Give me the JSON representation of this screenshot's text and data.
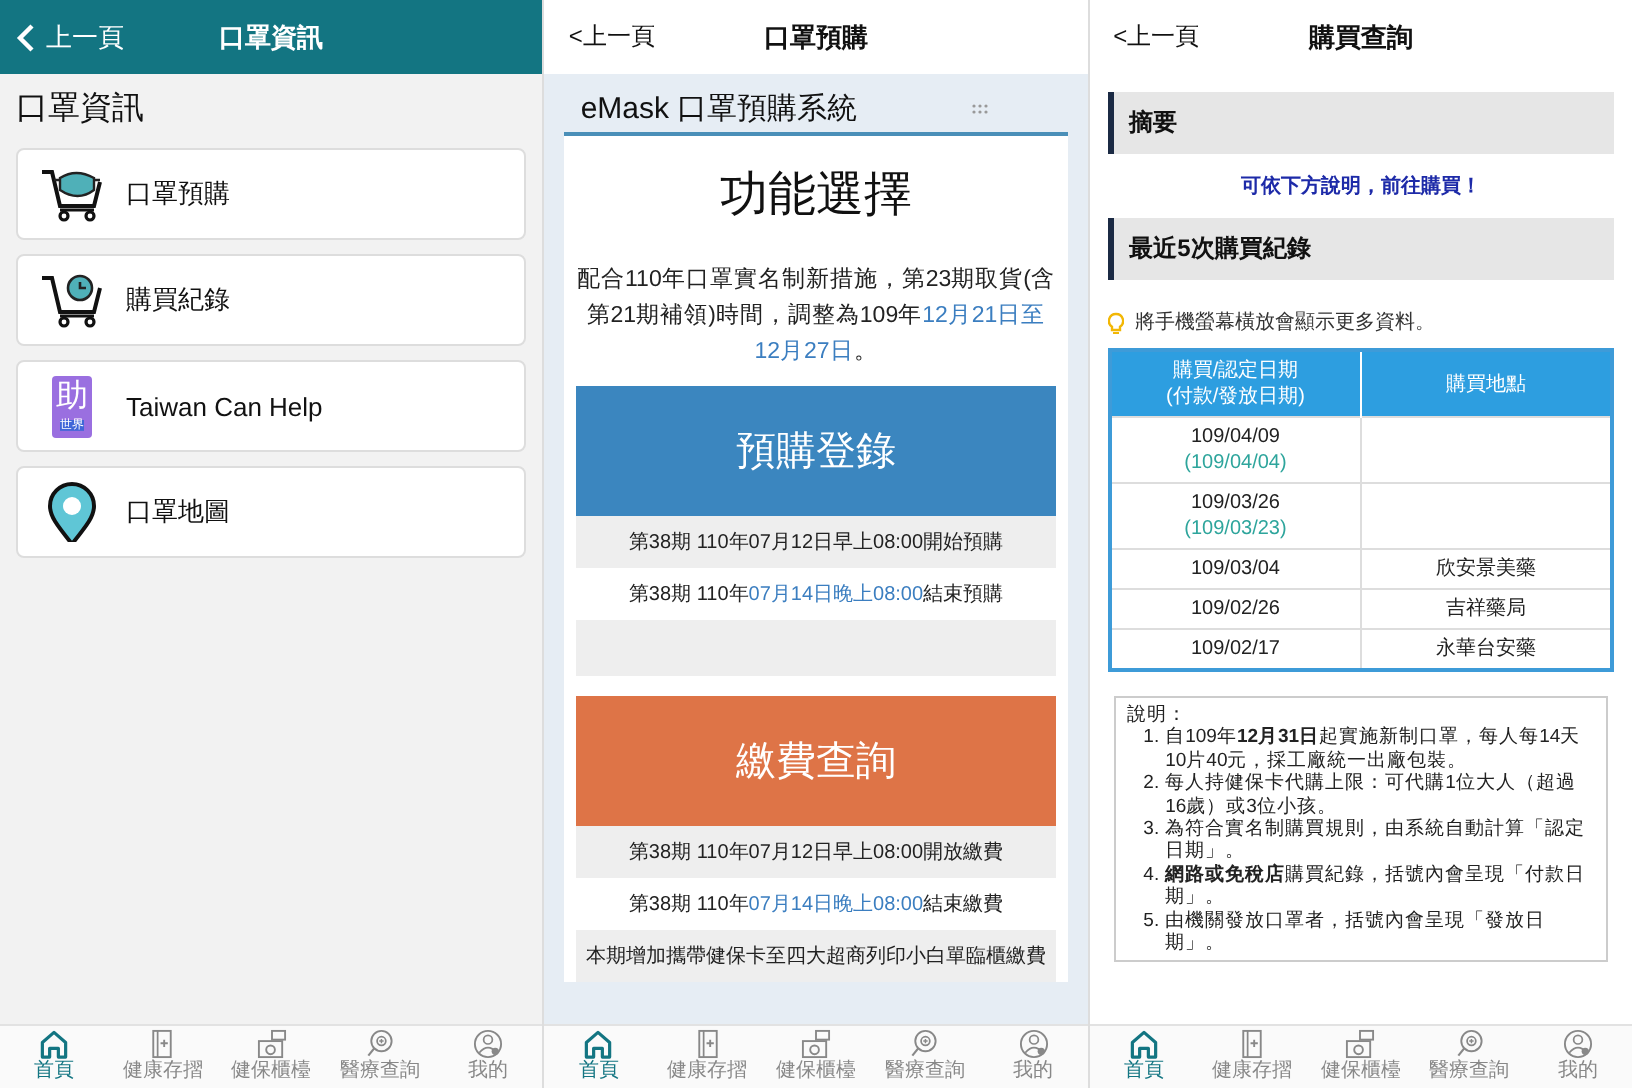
{
  "screens": [
    {
      "kind": "menu",
      "header": {
        "back": "上一頁",
        "title": "口罩資訊"
      },
      "heading": "口罩資訊",
      "items": [
        {
          "kind": "cart-mask",
          "label": "口罩預購"
        },
        {
          "kind": "cart-clock",
          "label": "購買紀錄"
        },
        {
          "kind": "badge",
          "badge_text": "助",
          "badge_caption": "世界",
          "label": "Taiwan Can Help"
        },
        {
          "kind": "pin",
          "label": "口罩地圖"
        }
      ],
      "nav": [
        {
          "kind": "home",
          "label": "首頁",
          "selected": true
        },
        {
          "kind": "passbook",
          "label": "健康存摺",
          "selected": false
        },
        {
          "kind": "counter",
          "label": "健保櫃檯",
          "selected": false
        },
        {
          "kind": "search",
          "label": "醫療查詢",
          "selected": false
        },
        {
          "kind": "profile",
          "label": "我的",
          "selected": false
        }
      ]
    },
    {
      "kind": "booking",
      "header": {
        "back": "<上一頁",
        "title": "口罩預購"
      },
      "system_title": "eMask 口罩預購系統",
      "heading": "功能選擇",
      "notice": [
        {
          "text": "配合110年口罩實名制新措施，第23期取貨(含第21期補領)時間，調整為109年",
          "highlight": false
        },
        {
          "text": "12月21日至12月27日",
          "highlight": true
        },
        {
          "text": "。",
          "highlight": false
        }
      ],
      "sections": [
        {
          "title": "預購登錄",
          "color": "#3b86bf",
          "lines": [
            {
              "kind": "text",
              "shaded": true,
              "segments": [
                {
                  "text": "第38期 110年07月12日早上08:00開始預購",
                  "highlight": false
                }
              ]
            },
            {
              "kind": "text",
              "shaded": false,
              "segments": [
                {
                  "text": "第38期 110年",
                  "highlight": false
                },
                {
                  "text": "07月14日晚上08:00",
                  "highlight": true
                },
                {
                  "text": "結束預購",
                  "highlight": false
                }
              ]
            },
            {
              "kind": "blank",
              "shaded": true
            }
          ]
        },
        {
          "title": "繳費查詢",
          "color": "#de7447",
          "lines": [
            {
              "kind": "text",
              "shaded": true,
              "segments": [
                {
                  "text": "第38期 110年07月12日早上08:00開放繳費",
                  "highlight": false
                }
              ]
            },
            {
              "kind": "text",
              "shaded": false,
              "segments": [
                {
                  "text": "第38期 110年",
                  "highlight": false
                },
                {
                  "text": "07月14日晚上08:00",
                  "highlight": true
                },
                {
                  "text": "結束繳費",
                  "highlight": false
                }
              ]
            },
            {
              "kind": "text",
              "shaded": true,
              "segments": [
                {
                  "text": "本期增加攜帶健保卡至四大超商列印小白單臨櫃繳費",
                  "highlight": false
                }
              ]
            }
          ]
        }
      ],
      "nav": [
        {
          "kind": "home",
          "label": "首頁",
          "selected": true
        },
        {
          "kind": "passbook",
          "label": "健康存摺",
          "selected": false
        },
        {
          "kind": "counter",
          "label": "健保櫃檯",
          "selected": false
        },
        {
          "kind": "search",
          "label": "醫療查詢",
          "selected": false
        },
        {
          "kind": "profile",
          "label": "我的",
          "selected": false
        }
      ]
    },
    {
      "kind": "records",
      "header": {
        "back": "<上一頁",
        "title": "購買查詢"
      },
      "summary": {
        "title": "摘要",
        "link": "可依下方說明，前往購買！"
      },
      "records": {
        "title": "最近5次購買紀錄",
        "tip": "將手機螢幕橫放會顯示更多資料。",
        "columns": [
          "購買/認定日期\n(付款/發放日期)",
          "購買地點"
        ],
        "rows": [
          {
            "date": "109/04/09",
            "sub_date": "(109/04/04)"
          },
          {
            "date": "109/03/26",
            "sub_date": "(109/03/23)"
          },
          {
            "date": "109/03/04",
            "place": "欣安景美藥"
          },
          {
            "date": "109/02/26",
            "place": "吉祥藥局"
          },
          {
            "date": "109/02/17",
            "place": "永華台安藥"
          }
        ]
      },
      "notes": {
        "label": "說明：",
        "items": [
          {
            "number": "1.",
            "text": "自109年**12月31日**起實施新制口罩，每人每14天10片40元，採工廠統一出廠包裝。"
          },
          {
            "number": "2.",
            "text": "每人持健保卡代購上限：可代購1位大人（超過16歲）或3位小孩。"
          },
          {
            "number": "3.",
            "text": "為符合實名制購買規則，由系統自動計算「認定日期」。"
          },
          {
            "number": "4.",
            "text": "**網路或免稅店**購買紀錄，括號內會呈現「付款日期」。"
          },
          {
            "number": "5.",
            "text": "由機關發放口罩者，括號內會呈現「發放日期」。"
          }
        ]
      },
      "nav": [
        {
          "kind": "home",
          "label": "首頁",
          "selected": true
        },
        {
          "kind": "passbook",
          "label": "健康存摺",
          "selected": false
        },
        {
          "kind": "counter",
          "label": "健保櫃檯",
          "selected": false
        },
        {
          "kind": "search",
          "label": "醫療查詢",
          "selected": false
        },
        {
          "kind": "profile",
          "label": "我的",
          "selected": false
        }
      ]
    }
  ]
}
